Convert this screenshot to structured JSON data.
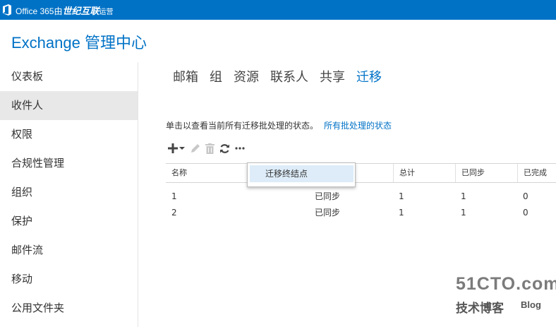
{
  "topbar": {
    "brand_prefix": "Office 365",
    "brand_by": "由",
    "brand_partner": "世纪互联",
    "brand_suffix": "运营",
    "bg_color": "#0072c6"
  },
  "app": {
    "title": "Exchange 管理中心",
    "accent_color": "#0072c6"
  },
  "sidebar": {
    "items": [
      {
        "label": "仪表板",
        "active": false
      },
      {
        "label": "收件人",
        "active": true
      },
      {
        "label": "权限",
        "active": false
      },
      {
        "label": "合规性管理",
        "active": false
      },
      {
        "label": "组织",
        "active": false
      },
      {
        "label": "保护",
        "active": false
      },
      {
        "label": "邮件流",
        "active": false
      },
      {
        "label": "移动",
        "active": false
      },
      {
        "label": "公用文件夹",
        "active": false
      }
    ]
  },
  "tabs": [
    {
      "label": "邮箱",
      "active": false
    },
    {
      "label": "组",
      "active": false
    },
    {
      "label": "资源",
      "active": false
    },
    {
      "label": "联系人",
      "active": false
    },
    {
      "label": "共享",
      "active": false
    },
    {
      "label": "迁移",
      "active": true
    }
  ],
  "content": {
    "description": "单击以查看当前所有迁移批处理的状态。",
    "status_link": "所有批处理的状态"
  },
  "toolbar": {
    "icons": [
      "add-icon",
      "chevron-down-icon",
      "edit-icon",
      "delete-icon",
      "refresh-icon",
      "more-icon"
    ]
  },
  "dropdown": {
    "item": "迁移终结点"
  },
  "grid": {
    "headers": {
      "name": "名称",
      "status": "",
      "total": "总计",
      "synced": "已同步",
      "done": "已完成"
    },
    "rows": [
      {
        "name": "1",
        "status": "已同步",
        "total": "1",
        "synced": "1",
        "done": "0"
      },
      {
        "name": "2",
        "status": "已同步",
        "total": "1",
        "synced": "1",
        "done": "0"
      }
    ]
  },
  "watermark": {
    "brand": "51CTO.com",
    "sub": "技术博客",
    "blog": "Blog"
  }
}
